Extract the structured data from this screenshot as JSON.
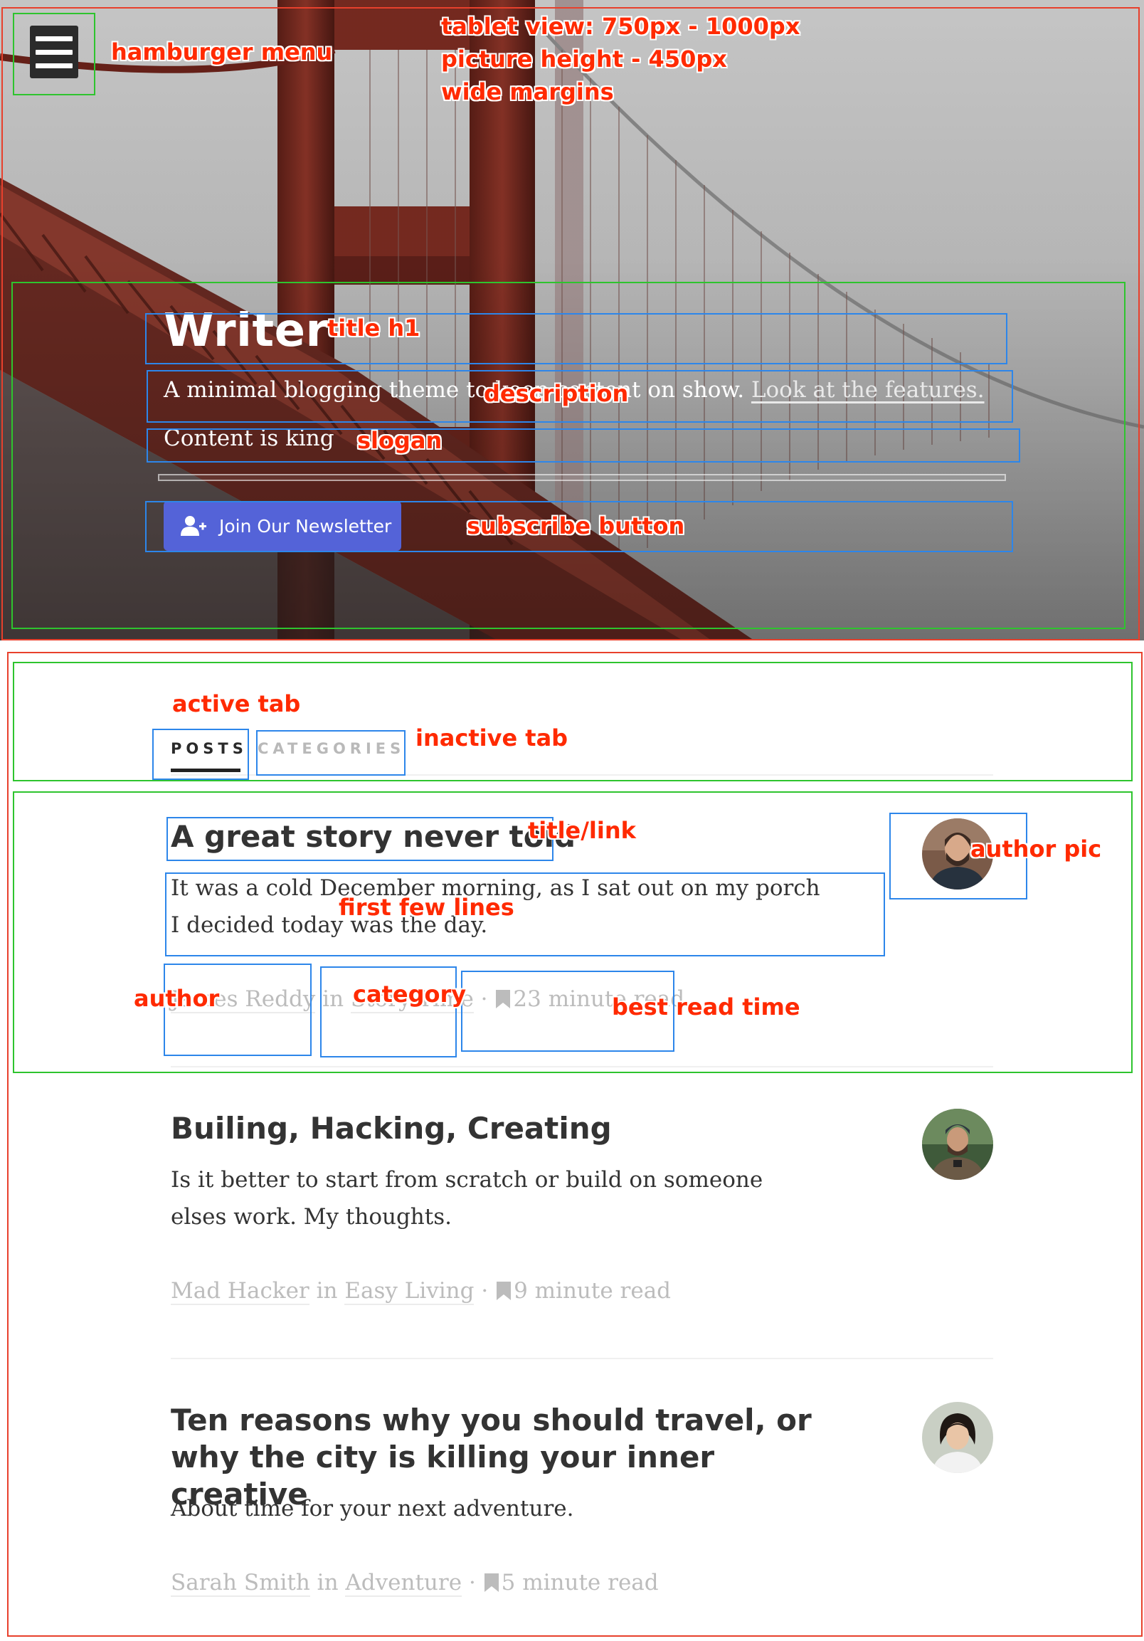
{
  "hero": {
    "menu_icon": "hamburger-icon",
    "title": "Writer",
    "description_prefix": "A minimal blogging theme to keep content on show. ",
    "description_link": "Look at the features.",
    "slogan": "Content is king",
    "subscribe_label": "Join Our Newsletter",
    "subscribe_icon": "user-plus-icon",
    "button_color": "#5463d8"
  },
  "tabs": [
    {
      "label": "POSTS",
      "active": true
    },
    {
      "label": "CATEGORIES",
      "active": false
    }
  ],
  "posts": [
    {
      "title": "A great story never told",
      "excerpt": "It was a cold December morning, as I sat out on my porch I decided today was the day.",
      "author": "James Reddy",
      "in_word": "in",
      "category": "Story Time",
      "separator": "·",
      "read_time": "23 minute read"
    },
    {
      "title": "Builing, Hacking, Creating",
      "excerpt": "Is it better to start from scratch or build on someone elses work. My thoughts.",
      "author": "Mad Hacker",
      "in_word": "in",
      "category": "Easy Living",
      "separator": "·",
      "read_time": "9 minute read"
    },
    {
      "title": "Ten reasons why you should travel, or why the city is killing your inner creative",
      "excerpt": "About time for your next adventure.",
      "author": "Sarah Smith",
      "in_word": "in",
      "category": "Adventure",
      "separator": "·",
      "read_time": "5 minute read"
    }
  ],
  "annotations": {
    "hamburger": "hamburger menu",
    "tablet_line1": "tablet view: 750px - 1000px",
    "tablet_line2": "picture height - 450px",
    "tablet_line3": "wide margins",
    "title_h1": "title h1",
    "description": "description",
    "slogan": "slogan",
    "subscribe": "subscribe button",
    "active_tab": "active tab",
    "inactive_tab": "inactive tab",
    "title_link": "title/link",
    "author_pic": "author pic",
    "first_lines": "first few lines",
    "author": "author",
    "category": "category",
    "read_time": "best read time",
    "color": "#ff2a00"
  }
}
